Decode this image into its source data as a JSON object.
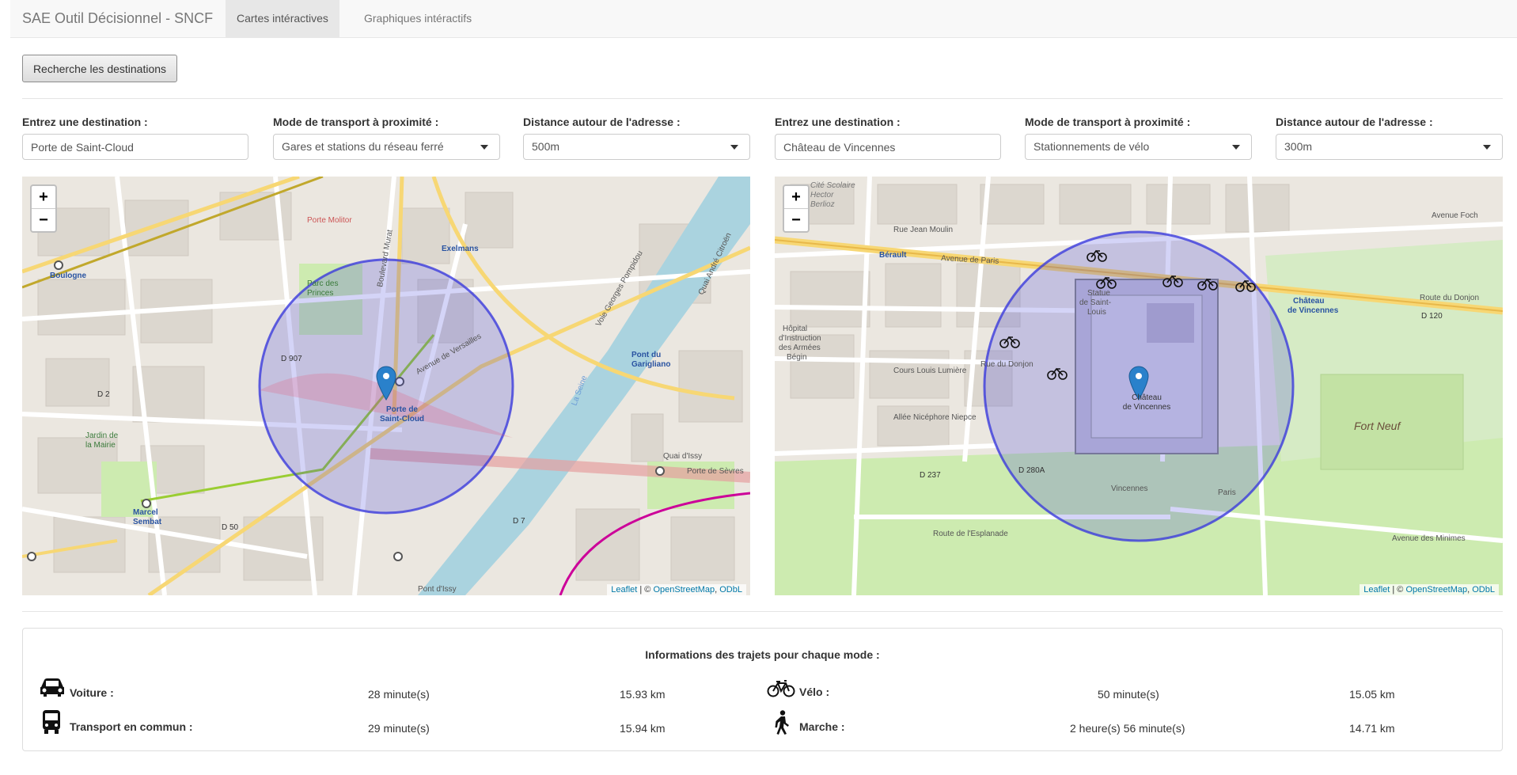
{
  "nav": {
    "brand": "SAE Outil Décisionnel - SNCF",
    "tabs": [
      "Cartes intéractives",
      "Graphiques intéractifs"
    ]
  },
  "search_button": "Recherche les destinations",
  "left": {
    "dest_label": "Entrez une destination :",
    "dest_value": "Porte de Saint-Cloud",
    "mode_label": "Mode de transport à proximité :",
    "mode_value": "Gares et stations du réseau ferré",
    "dist_label": "Distance autour de l'adresse :",
    "dist_value": "500m",
    "map": {
      "places": [
        "Boulogne Jean Jaurès",
        "Porte de Saint-Cloud",
        "Marcel Sembat",
        "Exelmans",
        "Pont du Garigliano",
        "Porte Molitor",
        "Avenue de Versailles",
        "Boulevard Murat",
        "Quai André Citroën",
        "Voie Georges Pompidou",
        "Porte de Sèvres",
        "Quai d'Issy",
        "D 907",
        "D 2",
        "D 50",
        "D 7",
        "Parc des Princes",
        "La Seine",
        "Jardin de la Mairie",
        "Pont d'Issy"
      ]
    }
  },
  "right": {
    "dest_label": "Entrez une destination :",
    "dest_value": "Château de Vincennes",
    "mode_label": "Mode de transport à proximité :",
    "mode_value": "Stationnements de vélo",
    "dist_label": "Distance autour de l'adresse :",
    "dist_value": "300m",
    "map": {
      "places": [
        "Château de Vincennes",
        "Avenue de Paris",
        "Bérault",
        "Statue de Saint-Louis",
        "Rue Jean Moulin",
        "Rue du Donjon",
        "Cours Louis Lumière",
        "Allée Nicéphore Niepce",
        "D 237",
        "D 280A",
        "D 120",
        "Fort Neuf",
        "Route de l'Esplanade",
        "Avenue des Minimes",
        "Vincennes",
        "Paris",
        "Hôpital d'Instruction des Armées Bégin",
        "Avenue Foch",
        "Route du Donjon",
        "Cité Scolaire Hector Berlioz"
      ]
    }
  },
  "attribution": {
    "leaflet": "Leaflet",
    "sep": " | © ",
    "osm": "OpenStreetMap",
    "odbl": "ODbL"
  },
  "info": {
    "title": "Informations des trajets pour chaque mode :",
    "rows": [
      {
        "mode": "Voiture :",
        "time": "28 minute(s)",
        "distance": "15.93 km",
        "icon": "car-icon"
      },
      {
        "mode": "Transport en commun :",
        "time": "29 minute(s)",
        "distance": "15.94 km",
        "icon": "bus-icon"
      },
      {
        "mode": "Vélo :",
        "time": "50 minute(s)",
        "distance": "15.05 km",
        "icon": "bicycle-icon"
      },
      {
        "mode": "Marche :",
        "time": "2 heure(s) 56 minute(s)",
        "distance": "14.71 km",
        "icon": "walking-icon"
      }
    ]
  },
  "colors": {
    "circle": "#3b3bdc",
    "marker": "#2a81cb",
    "road_yellow": "#f7d774",
    "river": "#aad3df",
    "park": "#cdebb0"
  }
}
